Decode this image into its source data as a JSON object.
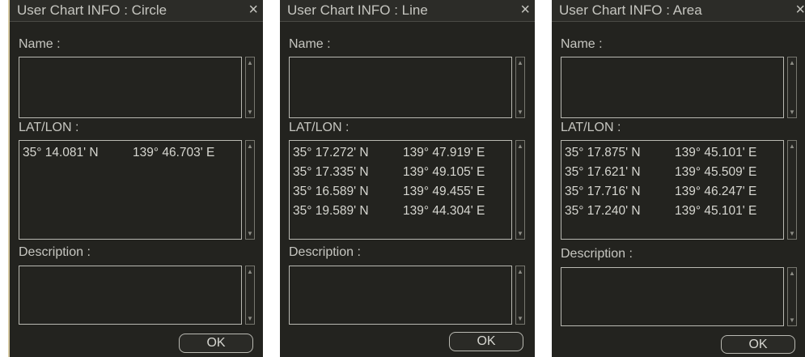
{
  "dialogs": [
    {
      "title": "User Chart INFO : Circle",
      "close_icon": "×",
      "name_label": "Name :",
      "name_value": "",
      "latlon_label": "LAT/LON :",
      "coordinates": [
        {
          "lat": "35° 14.081' N",
          "lon": "139° 46.703' E"
        }
      ],
      "description_label": "Description :",
      "description_value": "",
      "ok_label": "OK"
    },
    {
      "title": "User Chart INFO : Line",
      "close_icon": "×",
      "name_label": "Name :",
      "name_value": "",
      "latlon_label": "LAT/LON :",
      "coordinates": [
        {
          "lat": "35° 17.272' N",
          "lon": "139° 47.919' E"
        },
        {
          "lat": "35° 17.335' N",
          "lon": "139° 49.105' E"
        },
        {
          "lat": "35° 16.589' N",
          "lon": "139° 49.455' E"
        },
        {
          "lat": "35° 19.589' N",
          "lon": "139° 44.304' E"
        }
      ],
      "description_label": "Description :",
      "description_value": "",
      "ok_label": "OK"
    },
    {
      "title": "User Chart INFO : Area",
      "close_icon": "×",
      "name_label": "Name :",
      "name_value": "",
      "latlon_label": "LAT/LON :",
      "coordinates": [
        {
          "lat": "35° 17.875' N",
          "lon": "139° 45.101' E"
        },
        {
          "lat": "35° 17.621' N",
          "lon": "139° 45.509' E"
        },
        {
          "lat": "35° 17.716' N",
          "lon": "139° 46.247' E"
        },
        {
          "lat": "35° 17.240' N",
          "lon": "139° 45.101' E"
        }
      ],
      "description_label": "Description :",
      "description_value": "",
      "ok_label": "OK"
    }
  ],
  "icons": {
    "scroll_up": "▲",
    "scroll_down": "▼",
    "close": "×"
  },
  "colors": {
    "panel_background": "#23231f",
    "text": "#c6c6c0",
    "border": "#b9b9b2"
  }
}
